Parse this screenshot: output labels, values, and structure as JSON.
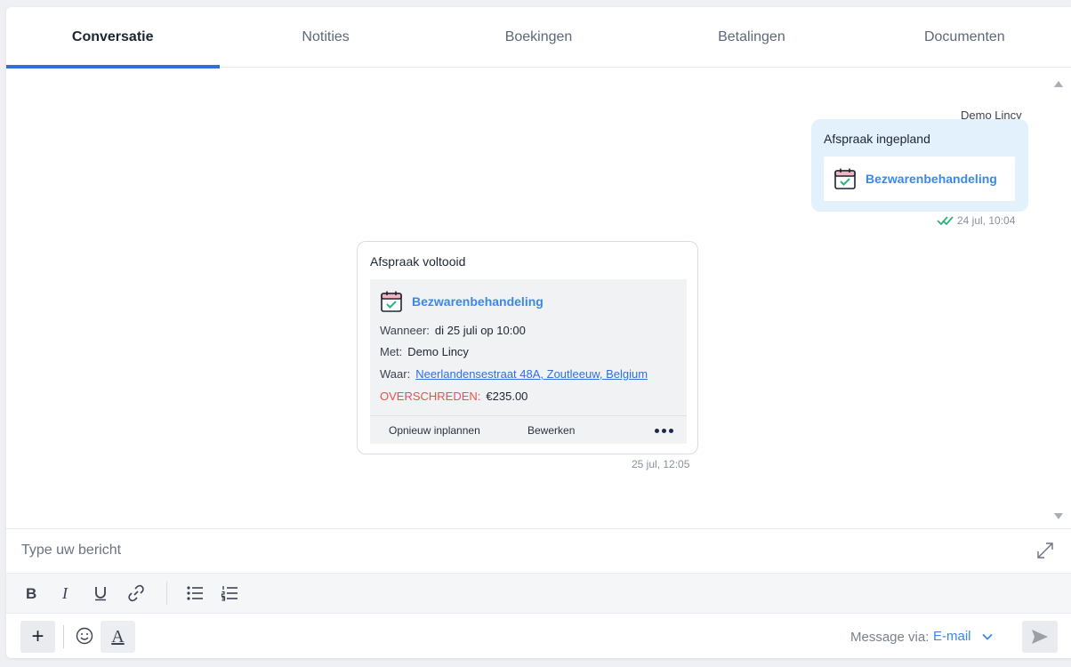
{
  "tabs": [
    {
      "label": "Conversatie",
      "active": true
    },
    {
      "label": "Notities"
    },
    {
      "label": "Boekingen"
    },
    {
      "label": "Betalingen"
    },
    {
      "label": "Documenten"
    }
  ],
  "messages": {
    "outgoing": {
      "sender": "Demo Lincy",
      "title": "Afspraak ingepland",
      "service": "Bezwarenbehandeling",
      "timestamp": "24 jul, 10:04",
      "status_icon": "double-check-icon"
    },
    "incoming": {
      "title": "Afspraak voltooid",
      "service": "Bezwarenbehandeling",
      "when_label": "Wanneer:",
      "when_value": "di 25 juli op 10:00",
      "with_label": "Met:",
      "with_value": "Demo Lincy",
      "where_label": "Waar:",
      "where_value": "Neerlandensestraat 48A, Zoutleeuw, Belgium",
      "status_label": "OVERSCHREDEN:",
      "amount": "€235.00",
      "action_reschedule": "Opnieuw inplannen",
      "action_edit": "Bewerken",
      "more_icon": "more-dots-icon",
      "timestamp": "25 jul, 12:05"
    }
  },
  "composer": {
    "placeholder": "Type uw bericht",
    "via_label": "Message via:",
    "via_value": "E-mail",
    "textformat_glyph": "A",
    "plus_glyph": "+"
  },
  "colors": {
    "accent": "#2f6fe0",
    "link": "#3b88e5",
    "warning": "#e5534b",
    "outgoing_bubble": "#e3f1fd",
    "check": "#2fb37e"
  }
}
